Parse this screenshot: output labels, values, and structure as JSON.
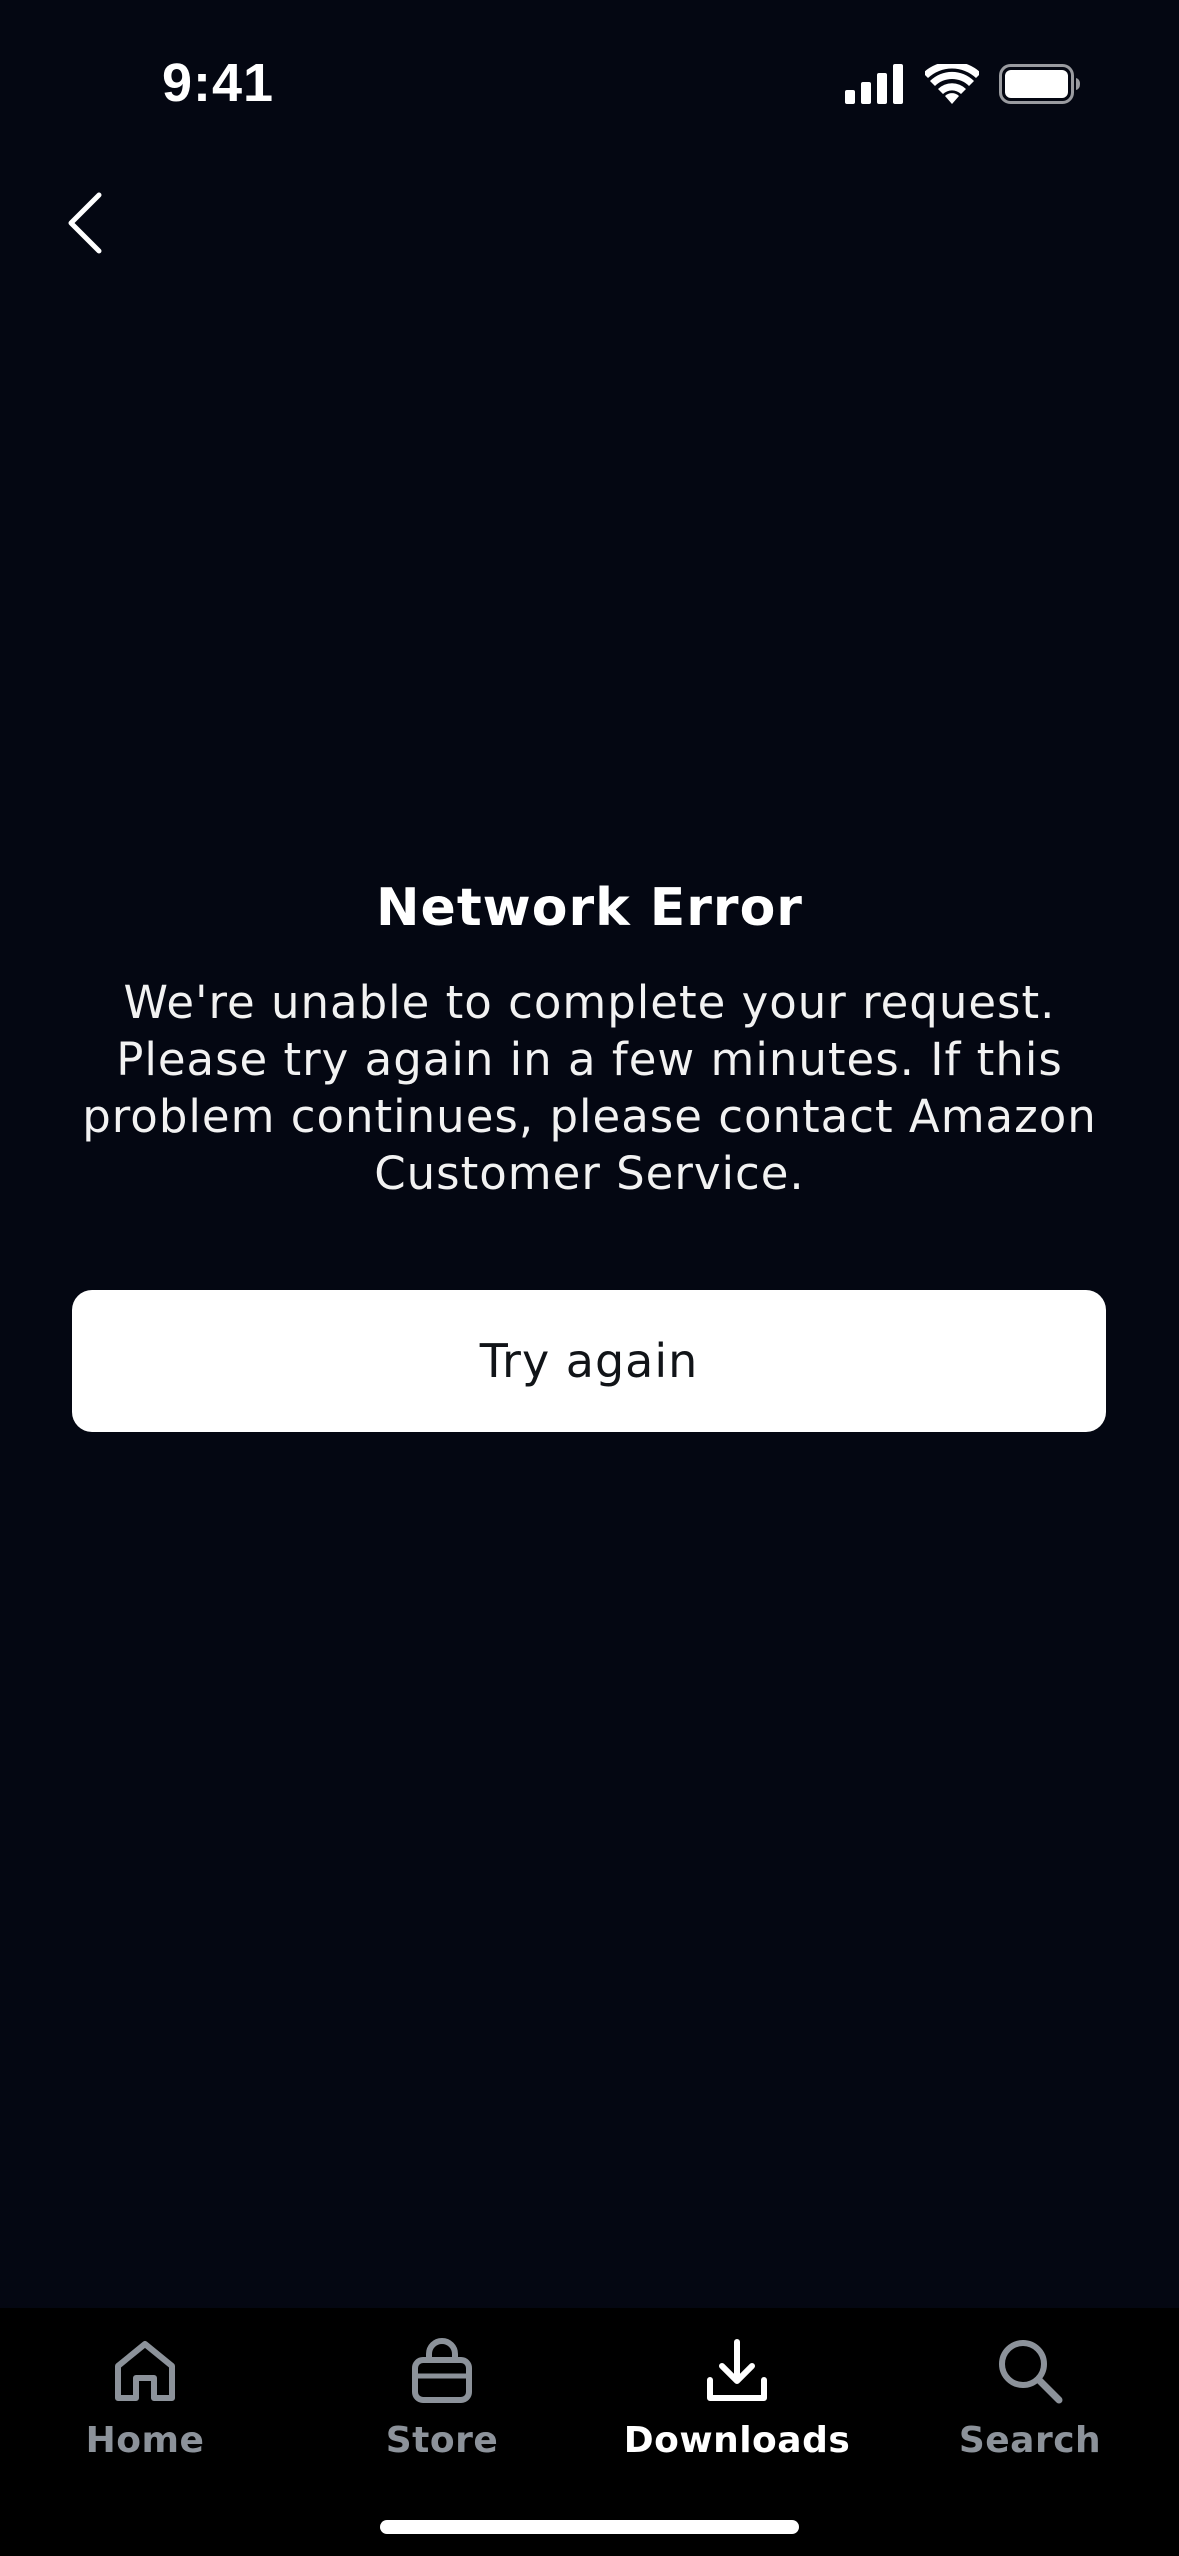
{
  "status_bar": {
    "time": "9:41",
    "icons": [
      "cellular-signal-icon",
      "wifi-icon",
      "battery-icon"
    ]
  },
  "nav": {
    "back_icon": "chevron-left-icon"
  },
  "error": {
    "title": "Network Error",
    "message": "We're unable to complete your request. Please try again in a few minutes. If this problem continues, please contact Amazon Customer Service.",
    "button_label": "Try again"
  },
  "tab_bar": {
    "tabs": [
      {
        "label": "Home",
        "icon": "home-icon",
        "active": false
      },
      {
        "label": "Store",
        "icon": "shopping-bag-icon",
        "active": false
      },
      {
        "label": "Downloads",
        "icon": "download-icon",
        "active": true
      },
      {
        "label": "Search",
        "icon": "search-icon",
        "active": false
      }
    ]
  },
  "colors": {
    "background": "#040712",
    "tab_bar_background": "#000000",
    "inactive_tab": "#8c929a",
    "active_tab": "#ffffff",
    "button_background": "#ffffff",
    "button_text": "#111418"
  }
}
